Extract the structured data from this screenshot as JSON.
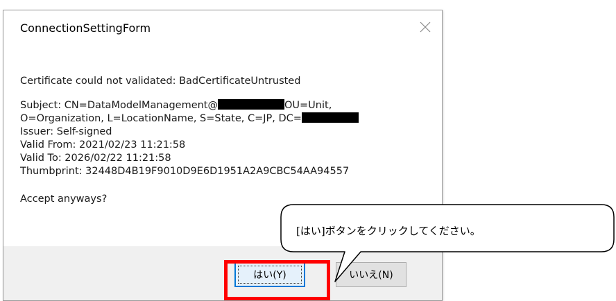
{
  "dialog": {
    "title": "ConnectionSettingForm",
    "message": {
      "line1": "Certificate could not validated: BadCertificateUntrusted",
      "subject_prefix": "Subject: CN=DataModelManagement@",
      "subject_suffix": "OU=Unit,",
      "line_org_prefix": "O=Organization, L=LocationName, S=State, C=JP, DC=",
      "issuer": "Issuer: Self-signed",
      "valid_from": "Valid From: 2021/02/23 11:21:58",
      "valid_to": "Valid To: 2026/02/22 11:21:58",
      "thumbprint": "Thumbprint: 32448D4B19F9010D9E6D1951A2A9CBC54AA94557",
      "question": "Accept anyways?"
    },
    "buttons": {
      "yes": "はい(Y)",
      "no": "いいえ(N)"
    }
  },
  "callout": {
    "text": "[はい]ボタンをクリックしてください。"
  },
  "colors": {
    "highlight": "#ff0000",
    "default_button_border": "#0078d7"
  },
  "icons": {
    "close": "close-icon"
  }
}
